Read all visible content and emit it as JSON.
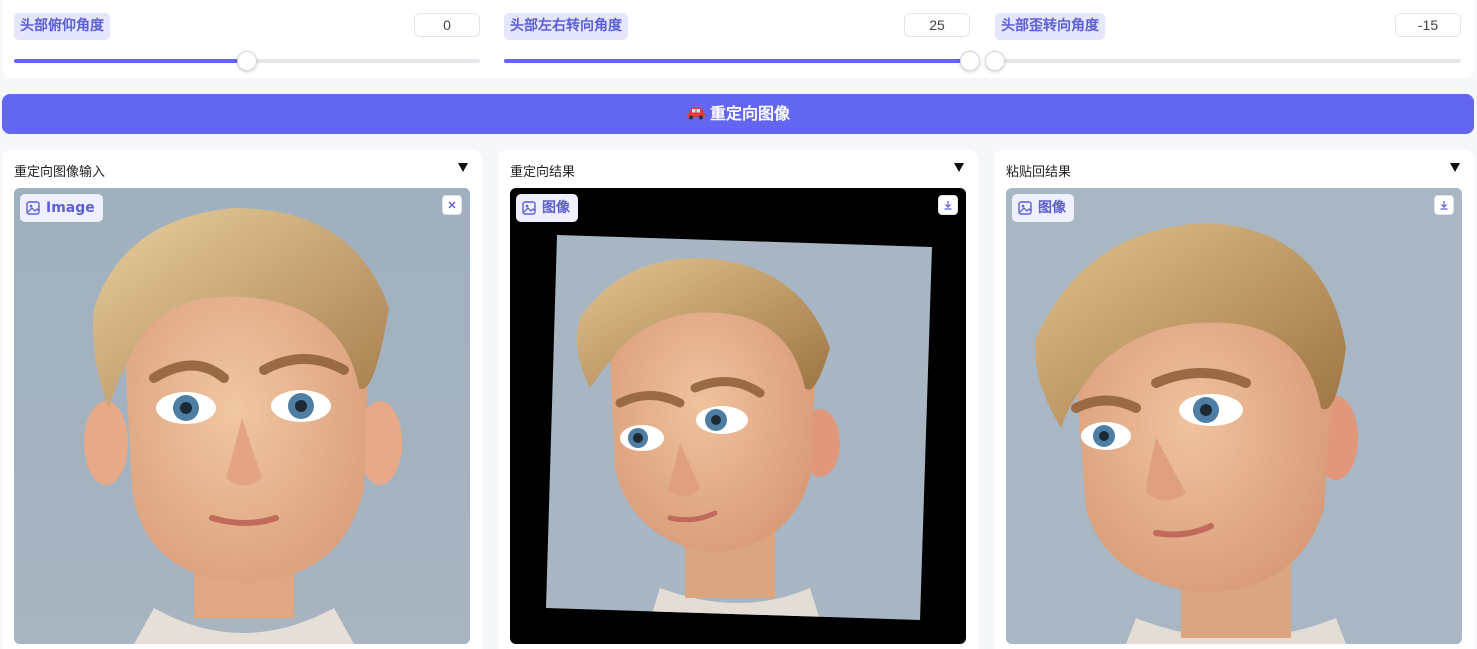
{
  "sliders": [
    {
      "label": "头部俯仰角度",
      "value": "0",
      "fraction": 0.5
    },
    {
      "label": "头部左右转向角度",
      "value": "25",
      "fraction": 1.0
    },
    {
      "label": "头部歪转向角度",
      "value": "-15",
      "fraction": 0.0
    }
  ],
  "main_button": {
    "label": "重定向图像",
    "icon": "car-icon"
  },
  "panels": [
    {
      "title": "重定向图像输入",
      "badge": "Image",
      "action_icon": "close-icon"
    },
    {
      "title": "重定向结果",
      "badge": "图像",
      "action_icon": "download-icon"
    },
    {
      "title": "粘贴回结果",
      "badge": "图像",
      "action_icon": "download-icon"
    }
  ],
  "colors": {
    "accent": "#6366f1",
    "badge_bg": "#eef0ff",
    "track": "#e6e7ee"
  }
}
